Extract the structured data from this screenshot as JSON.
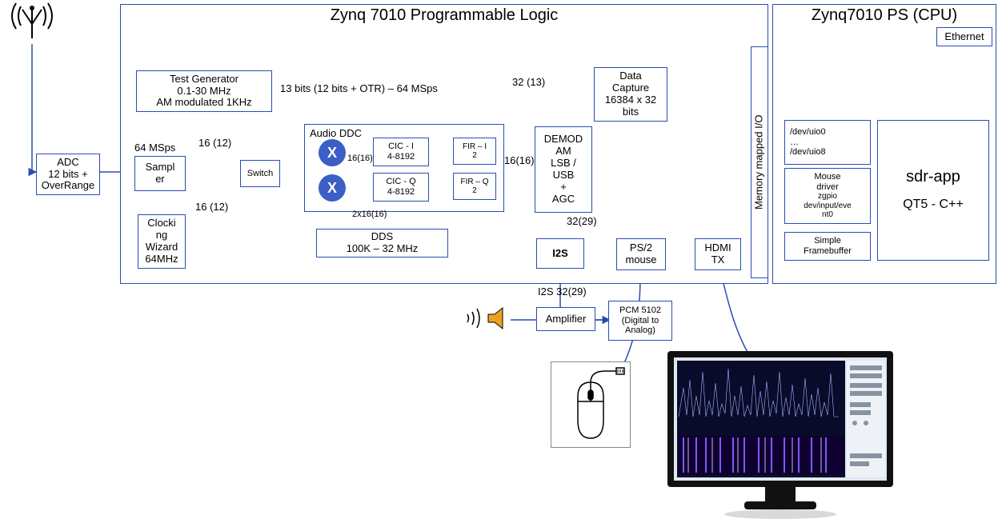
{
  "titles": {
    "pl": "Zynq 7010 Programmable Logic",
    "ps": "Zynq7010 PS (CPU)"
  },
  "blocks": {
    "adc": "ADC\n12 bits +\nOverRange",
    "sampler": "Sampl\ner",
    "sampler_rate": "64 MSps",
    "testgen": "Test Generator\n0.1-30 MHz\nAM modulated 1KHz",
    "switch": "Switch",
    "clkwiz": "Clocki\nng\nWizard\n64MHz",
    "audio_ddc": "Audio DDC",
    "cic_i": "CIC - I\n4-8192",
    "cic_q": "CIC - Q\n4-8192",
    "fir_i": "FIR – I\n2",
    "fir_q": "FIR – Q\n2",
    "dds": "DDS\n100K – 32 MHz",
    "demod": "DEMOD\nAM\nLSB /\nUSB\n+\nAGC",
    "datacap": "Data\nCapture\n16384 x 32\nbits",
    "i2s": "I2S",
    "ps2": "PS/2\nmouse",
    "hdmi": "HDMI\nTX",
    "mmio": "Memory mapped I/O",
    "uio": "/dev/uio0\n…\n/dev/uio8",
    "mousedrv": "Mouse\ndriver",
    "mousedrv_sub": "zgpio\ndev/input/eve\nnt0",
    "simplefb": "Simple\nFramebuffer",
    "sdrapp": "sdr-app",
    "sdrapp_sub": "QT5 - C++",
    "ethernet": "Ethernet",
    "amplifier": "Amplifier",
    "pcm": "PCM 5102\n(Digital to\nAnalog)"
  },
  "bus_labels": {
    "bits13": "13 bits (12 bits + OTR) – 64 MSps",
    "b32_13": "32 (13)",
    "b16_12_top": "16 (12)",
    "b16_12_bot": "16 (12)",
    "b16_16_i": "16(16)",
    "b16_16_out": "16(16)",
    "b2x16": "2x16(16)",
    "b32_29": "32(29)",
    "i2s_out": "I2S 32(29)"
  },
  "icons": {
    "mult": "X"
  }
}
